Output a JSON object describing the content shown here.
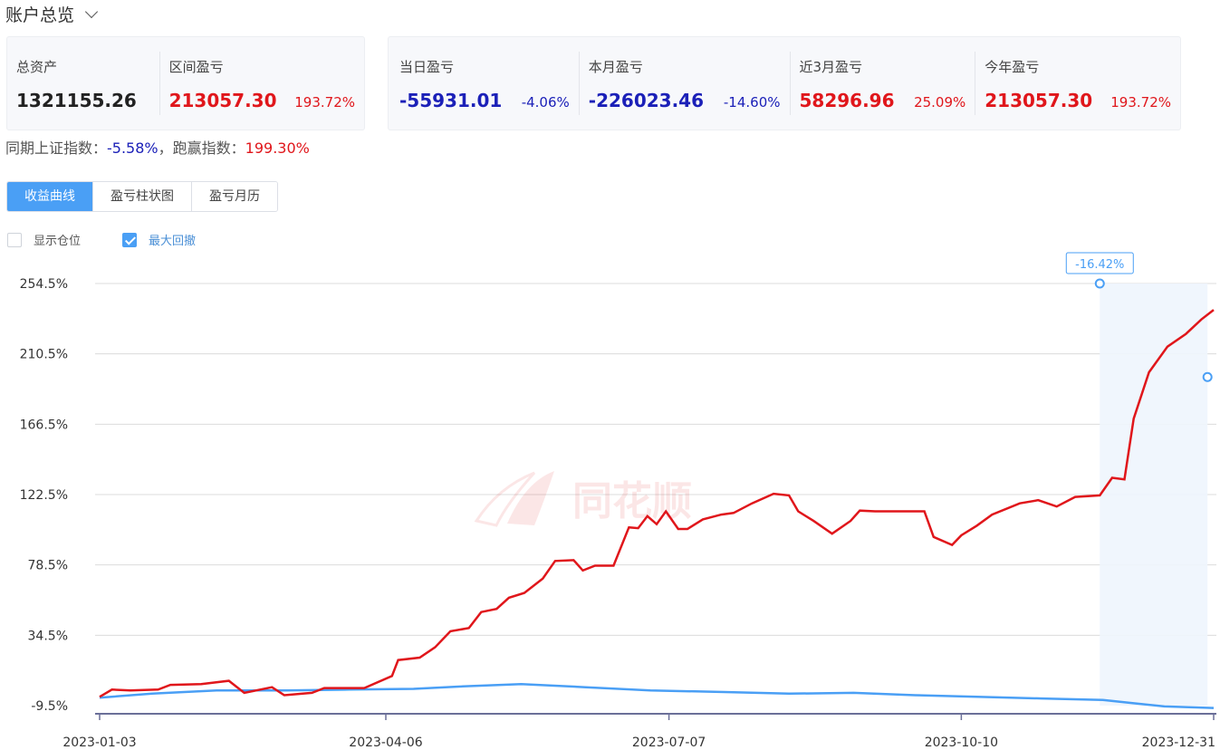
{
  "header": {
    "title": "账户总览"
  },
  "summary_left": [
    {
      "label": "总资产",
      "value": "1321155.26",
      "pct": ""
    },
    {
      "label": "区间盈亏",
      "value": "213057.30",
      "pct": "193.72%"
    }
  ],
  "summary_right": [
    {
      "label": "当日盈亏",
      "value": "-55931.01",
      "pct": "-4.06%"
    },
    {
      "label": "本月盈亏",
      "value": "-226023.46",
      "pct": "-14.60%"
    },
    {
      "label": "近3月盈亏",
      "value": "58296.96",
      "pct": "25.09%"
    },
    {
      "label": "今年盈亏",
      "value": "213057.30",
      "pct": "193.72%"
    }
  ],
  "index_compare": {
    "sse_label": "同期上证指数：",
    "sse_value": "-5.58%",
    "sep": "，",
    "beat_label": "跑赢指数：",
    "beat_value": "199.30%"
  },
  "tabs": [
    {
      "label": "收益曲线",
      "active": true
    },
    {
      "label": "盈亏柱状图",
      "active": false
    },
    {
      "label": "盈亏月历",
      "active": false
    }
  ],
  "options": [
    {
      "label": "显示仓位",
      "checked": false
    },
    {
      "label": "最大回撤",
      "checked": true
    }
  ],
  "colors": {
    "positive": "#e0161b",
    "negative": "#1b20b8",
    "accent": "#4a9ff5",
    "strategy_line": "#e0161b",
    "index_line": "#4a9ff5"
  },
  "watermark": "同花顺",
  "chart_data": {
    "type": "line",
    "y_tick_labels": [
      "254.5%",
      "210.5%",
      "166.5%",
      "122.5%",
      "78.5%",
      "34.5%",
      "-9.5%"
    ],
    "y_ticks": [
      254.5,
      210.5,
      166.5,
      122.5,
      78.5,
      34.5,
      -9.5
    ],
    "ylim": [
      -9.5,
      254.5
    ],
    "x_tick_labels": [
      "2023-01-03",
      "2023-04-06",
      "2023-07-07",
      "2023-10-10",
      "2023-12-31"
    ],
    "x_ticks": [
      "2023-01-03",
      "2023-04-06",
      "2023-07-07",
      "2023-10-10",
      "2023-12-31"
    ],
    "xlim": [
      "2023-01-03",
      "2023-12-31"
    ],
    "grid": true,
    "max_drawdown": {
      "label": "-16.42%",
      "start": "2023-11-24",
      "end": "2023-12-29",
      "peak_value": 254.5,
      "end_value": 196.0
    },
    "series": [
      {
        "values": [
          [
            "2023-01-03",
            -4.0
          ],
          [
            "2023-01-07",
            0.5
          ],
          [
            "2023-01-13",
            0.0
          ],
          [
            "2023-01-22",
            0.5
          ],
          [
            "2023-01-26",
            3.5
          ],
          [
            "2023-02-05",
            4.0
          ],
          [
            "2023-02-14",
            6.0
          ],
          [
            "2023-02-19",
            -1.5
          ],
          [
            "2023-02-28",
            2.0
          ],
          [
            "2023-03-04",
            -3.0
          ],
          [
            "2023-03-13",
            -1.5
          ],
          [
            "2023-03-17",
            1.5
          ],
          [
            "2023-03-30",
            1.5
          ],
          [
            "2023-04-08",
            9.0
          ],
          [
            "2023-04-10",
            19.0
          ],
          [
            "2023-04-17",
            20.5
          ],
          [
            "2023-04-22",
            27.0
          ],
          [
            "2023-04-27",
            37.0
          ],
          [
            "2023-05-03",
            39.0
          ],
          [
            "2023-05-07",
            49.0
          ],
          [
            "2023-05-12",
            51.0
          ],
          [
            "2023-05-16",
            58.0
          ],
          [
            "2023-05-21",
            61.0
          ],
          [
            "2023-05-27",
            70.0
          ],
          [
            "2023-05-31",
            81.0
          ],
          [
            "2023-06-06",
            81.5
          ],
          [
            "2023-06-09",
            75.0
          ],
          [
            "2023-06-13",
            78.0
          ],
          [
            "2023-06-19",
            78.0
          ],
          [
            "2023-06-24",
            102.0
          ],
          [
            "2023-06-27",
            101.5
          ],
          [
            "2023-06-30",
            109.0
          ],
          [
            "2023-07-03",
            104.0
          ],
          [
            "2023-07-06",
            112.0
          ],
          [
            "2023-07-10",
            101.0
          ],
          [
            "2023-07-13",
            101.0
          ],
          [
            "2023-07-18",
            107.0
          ],
          [
            "2023-07-24",
            110.0
          ],
          [
            "2023-07-28",
            111.0
          ],
          [
            "2023-08-03",
            117.0
          ],
          [
            "2023-08-10",
            123.0
          ],
          [
            "2023-08-15",
            122.0
          ],
          [
            "2023-08-18",
            112.0
          ],
          [
            "2023-08-23",
            106.0
          ],
          [
            "2023-08-29",
            98.0
          ],
          [
            "2023-09-04",
            106.0
          ],
          [
            "2023-09-07",
            112.5
          ],
          [
            "2023-09-12",
            112.0
          ],
          [
            "2023-09-28",
            112.0
          ],
          [
            "2023-10-01",
            96.0
          ],
          [
            "2023-10-07",
            91.0
          ],
          [
            "2023-10-10",
            97.0
          ],
          [
            "2023-10-15",
            103.0
          ],
          [
            "2023-10-20",
            110.0
          ],
          [
            "2023-10-29",
            117.0
          ],
          [
            "2023-11-04",
            119.0
          ],
          [
            "2023-11-10",
            115.0
          ],
          [
            "2023-11-16",
            121.0
          ],
          [
            "2023-11-24",
            122.0
          ],
          [
            "2023-11-28",
            133.0
          ],
          [
            "2023-12-02",
            132.0
          ],
          [
            "2023-12-05",
            170.0
          ],
          [
            "2023-12-10",
            199.0
          ],
          [
            "2023-12-16",
            215.0
          ],
          [
            "2023-12-22",
            223.0
          ],
          [
            "2023-12-27",
            232.0
          ],
          [
            "2023-12-31",
            238.0
          ]
        ]
      },
      {
        "values": [
          [
            "2023-01-03",
            -4.5
          ],
          [
            "2023-01-20",
            -2.0
          ],
          [
            "2023-02-10",
            0.0
          ],
          [
            "2023-03-05",
            0.0
          ],
          [
            "2023-03-25",
            0.5
          ],
          [
            "2023-04-15",
            1.0
          ],
          [
            "2023-05-01",
            2.5
          ],
          [
            "2023-05-20",
            4.0
          ],
          [
            "2023-06-10",
            2.0
          ],
          [
            "2023-07-01",
            0.0
          ],
          [
            "2023-07-25",
            -1.0
          ],
          [
            "2023-08-15",
            -2.0
          ],
          [
            "2023-09-05",
            -1.5
          ],
          [
            "2023-09-25",
            -3.0
          ],
          [
            "2023-10-15",
            -4.0
          ],
          [
            "2023-11-05",
            -5.0
          ],
          [
            "2023-11-25",
            -6.0
          ],
          [
            "2023-12-05",
            -8.0
          ],
          [
            "2023-12-15",
            -10.0
          ],
          [
            "2023-12-31",
            -11.0
          ]
        ]
      }
    ]
  }
}
